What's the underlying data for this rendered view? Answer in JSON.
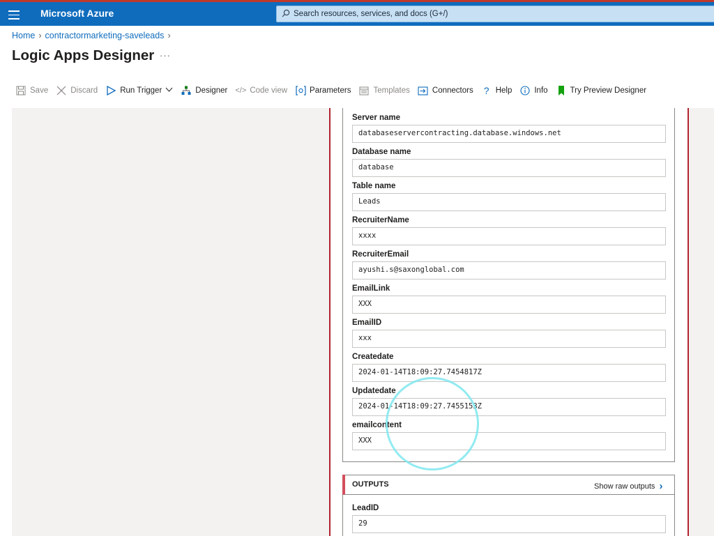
{
  "topbar": {
    "brand": "Microsoft Azure",
    "search_placeholder": "Search resources, services, and docs (G+/)"
  },
  "breadcrumb": {
    "home": "Home",
    "resource": "contractormarketing-saveleads"
  },
  "page": {
    "title": "Logic Apps Designer",
    "more": "···"
  },
  "toolbar": {
    "save": "Save",
    "discard": "Discard",
    "run_trigger": "Run Trigger",
    "designer": "Designer",
    "code_view": "Code view",
    "parameters": "Parameters",
    "templates": "Templates",
    "connectors": "Connectors",
    "help": "Help",
    "info": "Info",
    "try_preview": "Try Preview Designer"
  },
  "inputs": {
    "fields": [
      {
        "label": "Server name",
        "value": "databaseservercontracting.database.windows.net"
      },
      {
        "label": "Database name",
        "value": "database"
      },
      {
        "label": "Table name",
        "value": "Leads"
      },
      {
        "label": "RecruiterName",
        "value": "xxxx"
      },
      {
        "label": "RecruiterEmail",
        "value": "ayushi.s@saxonglobal.com"
      },
      {
        "label": "EmailLink",
        "value": "XXX"
      },
      {
        "label": "EmailID",
        "value": "xxx"
      },
      {
        "label": "Createdate",
        "value": "2024-01-14T18:09:27.7454817Z"
      },
      {
        "label": "Updatedate",
        "value": "2024-01-14T18:09:27.7455153Z"
      },
      {
        "label": "emailcontent",
        "value": "XXX"
      }
    ]
  },
  "outputs": {
    "title": "OUTPUTS",
    "show_raw": "Show raw outputs",
    "fields": [
      {
        "label": "LeadID",
        "value": "29"
      }
    ]
  },
  "colors": {
    "topbar": "#0f6cbd",
    "card_border": "#b0232f",
    "link": "#0f6cbd",
    "annotation": "#7fe7ef"
  }
}
